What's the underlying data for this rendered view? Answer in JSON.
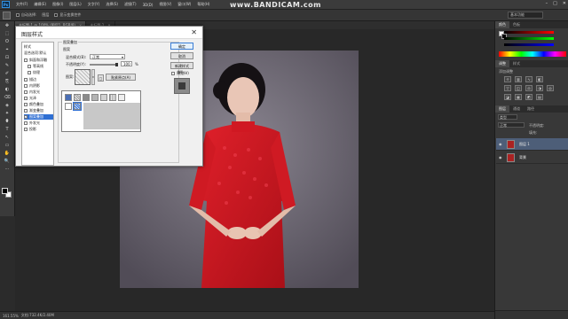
{
  "watermark": "www.BANDICAM.com",
  "menubar": {
    "logo": "Ps",
    "items": [
      "文件(F)",
      "编辑(E)",
      "图像(I)",
      "图层(L)",
      "文字(Y)",
      "选择(S)",
      "滤镜(T)",
      "3D(D)",
      "视图(V)",
      "窗口(W)",
      "帮助(H)"
    ],
    "window_buttons": [
      "–",
      "□",
      "✕"
    ]
  },
  "optbar": {
    "items": [
      "自动选择:",
      "图层",
      "显示变换控件"
    ],
    "workspace": "基本功能"
  },
  "tabs": [
    {
      "label": "未标题-1 @ 100% (图层1, RGB/8)",
      "active": true
    },
    {
      "label": "未标题-2",
      "active": false
    }
  ],
  "toolbox": {
    "tools": [
      "✥",
      "⬚",
      "ʘ",
      "⌖",
      "⊡",
      "✎",
      "✐",
      "⎘",
      "◐",
      "⌫",
      "◈",
      "✦",
      "⬮",
      "T",
      "↖",
      "▭",
      "✋",
      "🔍",
      "⋯"
    ]
  },
  "statusbar": {
    "zoom": "161.55%",
    "doc": "文档:732.4K/2.40M"
  },
  "right_panel": {
    "tabs_top": [
      "颜色",
      "色板"
    ],
    "tabs_adjust": [
      "调整",
      "样式"
    ],
    "adjust_hint": "添加调整",
    "tabs_layers": [
      "图层",
      "通道",
      "路径"
    ],
    "layers_kind": "类型",
    "blend_mode": "正常",
    "opacity_label": "不透明度:",
    "fill_label": "填充:",
    "layers": [
      {
        "name": "图层 1",
        "selected": true
      },
      {
        "name": "背景",
        "selected": false
      }
    ]
  },
  "colors": {
    "accent_selection": "#2f6fd3",
    "dress_red": "#c8141c",
    "canvas_bg": "#6f6a74",
    "app_dark": "#2b2b2b"
  },
  "dialog": {
    "title": "图层样式",
    "close": "✕",
    "style_list_header": "样式",
    "blend_options": "混合选项:默认",
    "effects": [
      {
        "label": "斜面和浮雕",
        "checked": false
      },
      {
        "label": "等高线",
        "checked": false
      },
      {
        "label": "纹理",
        "checked": false
      },
      {
        "label": "描边",
        "checked": false
      },
      {
        "label": "内阴影",
        "checked": false
      },
      {
        "label": "内发光",
        "checked": false
      },
      {
        "label": "光泽",
        "checked": false
      },
      {
        "label": "颜色叠加",
        "checked": false
      },
      {
        "label": "渐变叠加",
        "checked": false
      },
      {
        "label": "图案叠加",
        "checked": true,
        "selected": true
      },
      {
        "label": "外发光",
        "checked": false
      },
      {
        "label": "投影",
        "checked": false
      }
    ],
    "group_title": "图案叠加",
    "sub_group": "图案",
    "blend_mode_label": "混合模式(B):",
    "blend_mode_value": "正常",
    "opacity_label": "不透明度(Y):",
    "opacity_value": "100",
    "opacity_unit": "%",
    "pattern_label": "图案:",
    "snap_button": "贴紧原点(A)",
    "buttons": {
      "ok": "确定",
      "cancel": "取消",
      "new_style": "新建样式(W)...",
      "preview": "预览(V)"
    }
  }
}
